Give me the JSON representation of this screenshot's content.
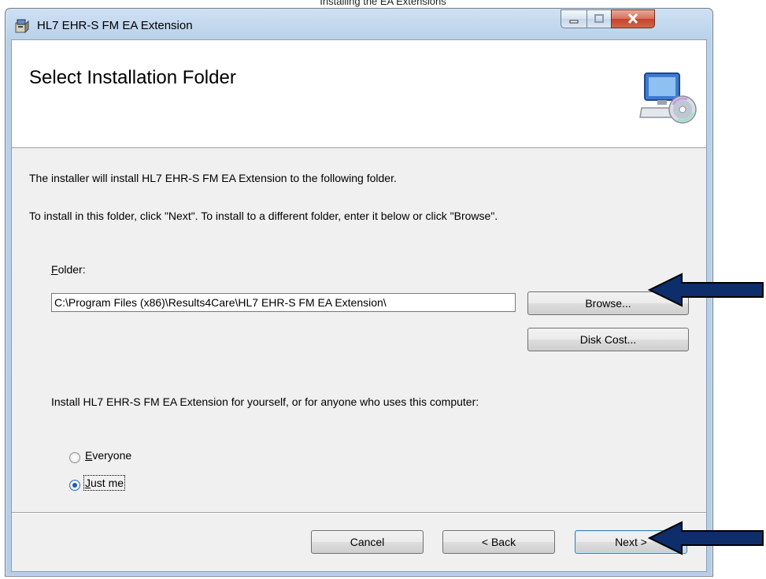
{
  "page_caption": "Installing the EA Extensions",
  "window": {
    "title": "HL7 EHR-S FM EA Extension",
    "controls": [
      "minimize",
      "maximize",
      "close"
    ]
  },
  "banner": {
    "heading": "Select Installation Folder",
    "icon": "computer-cd-icon"
  },
  "body": {
    "line1": "The installer will install HL7 EHR-S FM EA Extension to the following folder.",
    "line2": "To install in this folder, click \"Next\". To install to a different folder, enter it below or click \"Browse\".",
    "folder_label_first": "F",
    "folder_label_rest": "older:",
    "folder_value": "C:\\Program Files (x86)\\Results4Care\\HL7 EHR-S FM EA Extension\\",
    "browse_label": "Browse...",
    "disk_cost_label": "Disk Cost...",
    "install_for_text": "Install HL7 EHR-S FM EA Extension for yourself, or for anyone who uses this computer:",
    "radio_everyone_first": "E",
    "radio_everyone_rest": "veryone",
    "radio_justme_first": "J",
    "radio_justme_rest": "ust me",
    "selected_option": "Just me"
  },
  "footer": {
    "cancel_label": "Cancel",
    "back_label": "< Back",
    "next_label": "Next >"
  },
  "annotations": {
    "arrow_color": "#0d2d6b"
  }
}
